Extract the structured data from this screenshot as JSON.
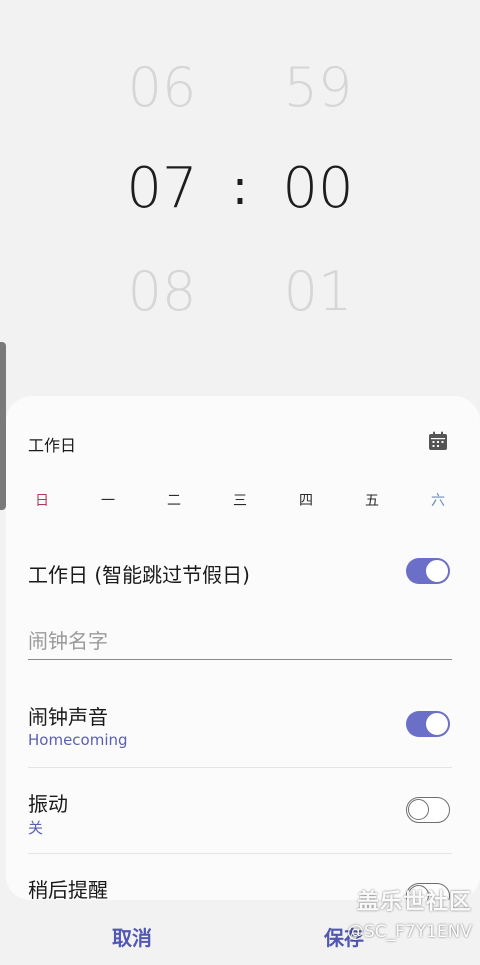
{
  "time_picker": {
    "hour_prev": "06",
    "hour_selected": "07",
    "hour_next": "08",
    "separator": ":",
    "minute_prev": "59",
    "minute_selected": "00",
    "minute_next": "01"
  },
  "repeat": {
    "title": "工作日",
    "calendar_icon": "calendar-icon",
    "days": [
      "日",
      "一",
      "二",
      "三",
      "四",
      "五",
      "六"
    ]
  },
  "settings": {
    "workday_label": "工作日 (智能跳过节假日)",
    "workday_on": true,
    "alarm_name_placeholder": "闹钟名字",
    "alarm_name_value": "",
    "sound_label": "闹钟声音",
    "sound_value": "Homecoming",
    "sound_on": true,
    "vibration_label": "振动",
    "vibration_value": "关",
    "vibration_on": false,
    "snooze_label": "稍后提醒",
    "snooze_on": false
  },
  "bottom_bar": {
    "cancel_label": "取消",
    "save_label": "保存"
  },
  "watermark": {
    "logo_text": "盖乐世社区",
    "user_text": "@SC_F7Y1ENV"
  },
  "colors": {
    "accent": "#6b6fc7",
    "button_text": "#5257b4",
    "sunday": "#b0385a",
    "saturday": "#6e8fb8"
  }
}
